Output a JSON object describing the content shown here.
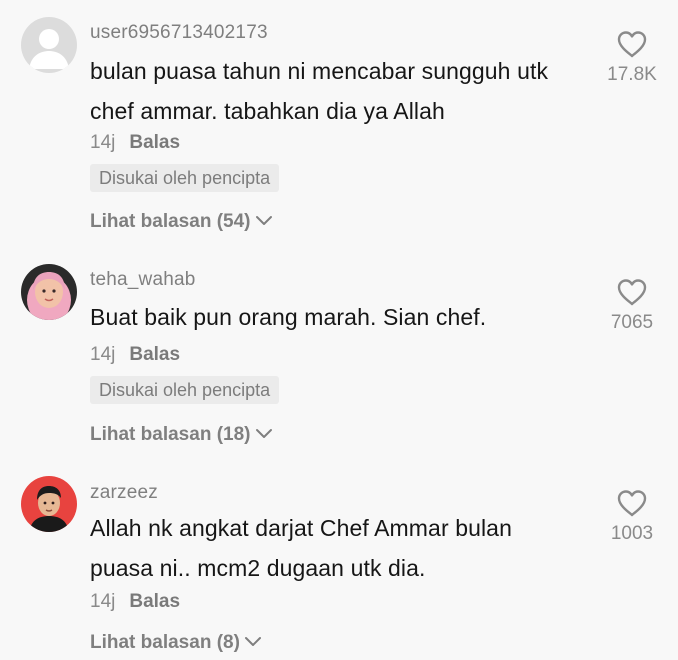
{
  "comments": [
    {
      "username": "user6956713402173",
      "text": "bulan puasa tahun ni mencabar sungguh utk chef ammar. tabahkan dia ya Allah",
      "time": "14j",
      "reply_label": "Balas",
      "badge": "Disukai oleh pencipta",
      "view_replies": "Lihat balasan (54)",
      "likes": "17.8K",
      "avatar": "default-avatar"
    },
    {
      "username": "teha_wahab",
      "text": "Buat baik pun orang marah. Sian chef.",
      "time": "14j",
      "reply_label": "Balas",
      "badge": "Disukai oleh pencipta",
      "view_replies": "Lihat balasan (18)",
      "likes": "7065",
      "avatar": "hijab-profile-photo"
    },
    {
      "username": "zarzeez",
      "text": "Allah nk angkat darjat Chef Ammar bulan puasa ni.. mcm2 dugaan utk dia.",
      "time": "14j",
      "reply_label": "Balas",
      "view_replies": "Lihat balasan (8)",
      "likes": "1003",
      "avatar": "man-profile-photo"
    }
  ],
  "colors": {
    "background": "#f8f8f8",
    "text": "#161616",
    "muted": "#8a8a8a",
    "badge_bg": "#ebebeb",
    "avatar3_bg": "#e8433f"
  }
}
